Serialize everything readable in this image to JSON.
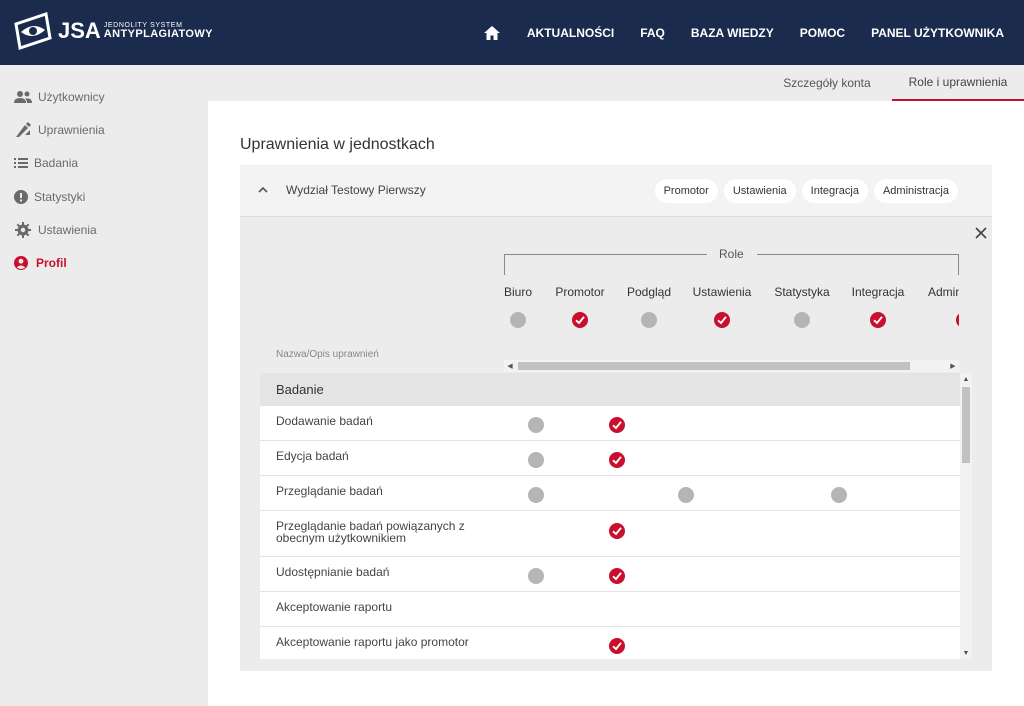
{
  "brand": {
    "mark": "JSA",
    "line1": "JEDNOLITY SYSTEM",
    "line2": "ANTYPLAGIATOWY"
  },
  "nav": {
    "home_icon": "home-icon",
    "items": [
      "AKTUALNOŚCI",
      "FAQ",
      "BAZA WIEDZY",
      "POMOC",
      "PANEL UŻYTKOWNIKA"
    ]
  },
  "sidebar": {
    "items": [
      {
        "label": "Użytkownicy",
        "icon": "users-icon",
        "active": false
      },
      {
        "label": "Uprawnienia",
        "icon": "permissions-icon",
        "active": false
      },
      {
        "label": "Badania",
        "icon": "list-icon",
        "active": false
      },
      {
        "label": "Statystyki",
        "icon": "alert-icon",
        "active": false
      },
      {
        "label": "Ustawienia",
        "icon": "gear-icon",
        "active": false
      },
      {
        "label": "Profil",
        "icon": "user-circle-icon",
        "active": true
      }
    ]
  },
  "tabs": [
    "Szczegóły konta",
    "Role i uprawnienia"
  ],
  "active_tab": "Role i uprawnienia",
  "page_title": "Uprawnienia w jednostkach",
  "unit": {
    "name": "Wydział Testowy Pierwszy",
    "chips": [
      "Promotor",
      "Ustawienia",
      "Integracja",
      "Administracja"
    ]
  },
  "roles_label": "Role",
  "roles": [
    {
      "name": "Biuro",
      "assigned": false
    },
    {
      "name": "Promotor",
      "assigned": true
    },
    {
      "name": "Podgląd",
      "assigned": false
    },
    {
      "name": "Ustawienia",
      "assigned": true
    },
    {
      "name": "Statystyka",
      "assigned": false
    },
    {
      "name": "Integracja",
      "assigned": true
    },
    {
      "name": "Administracja",
      "assigned": true
    }
  ],
  "column_header": "Nazwa/Opis uprawnień",
  "group": "Badanie",
  "permissions": [
    {
      "name": "Dodawanie badań",
      "cells": [
        "dot",
        "check",
        null,
        null,
        null
      ]
    },
    {
      "name": "Edycja badań",
      "cells": [
        "dot",
        "check",
        null,
        null,
        null
      ]
    },
    {
      "name": "Przeglądanie badań",
      "cells": [
        "dot",
        null,
        "dot",
        null,
        "dot"
      ]
    },
    {
      "name": "Przeglądanie badań powiązanych z obecnym użytkownikiem",
      "cells": [
        null,
        "check",
        null,
        null,
        null
      ]
    },
    {
      "name": "Udostępnianie badań",
      "cells": [
        "dot",
        "check",
        null,
        null,
        null
      ]
    },
    {
      "name": "Akceptowanie raportu",
      "cells": [
        null,
        null,
        null,
        null,
        null
      ]
    },
    {
      "name": "Akceptowanie raportu jako promotor",
      "cells": [
        null,
        "check",
        null,
        null,
        null
      ]
    }
  ],
  "colors": {
    "header_bg": "#1a2b4e",
    "accent": "#c8102e",
    "inactive_dot": "#b5b5b5"
  }
}
